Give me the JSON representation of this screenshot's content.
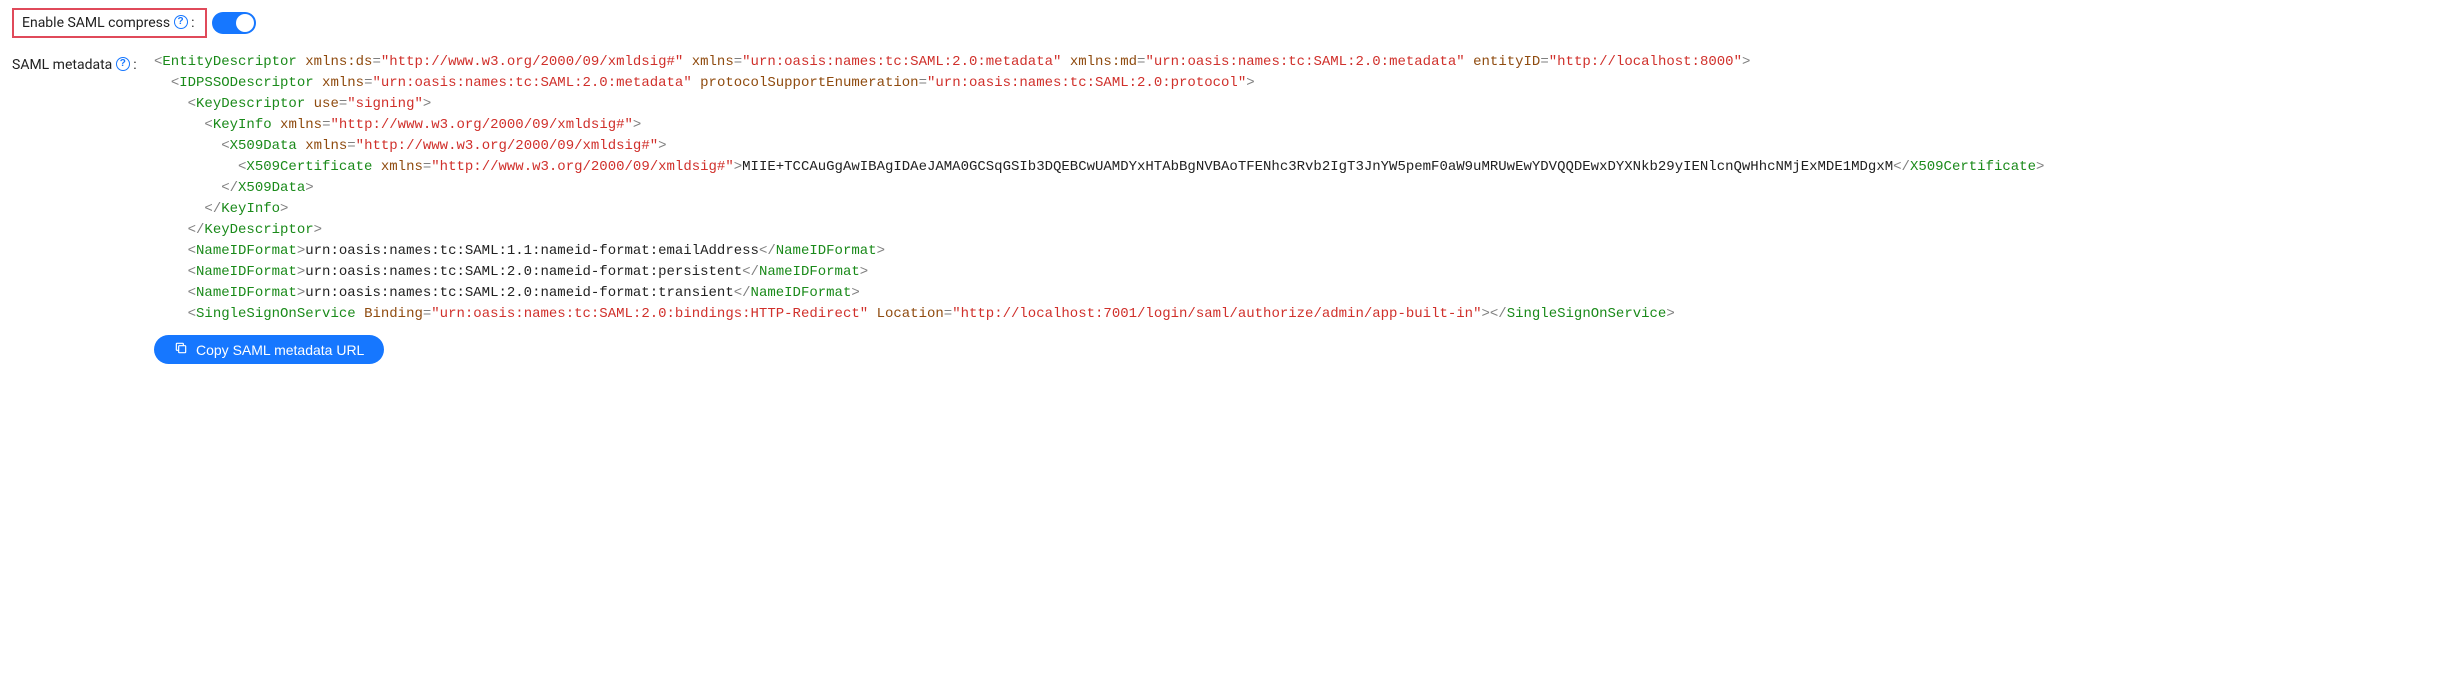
{
  "enable_compress": {
    "label": "Enable SAML compress",
    "help_tooltip": "Help",
    "value": true
  },
  "metadata": {
    "label": "SAML metadata",
    "help_tooltip": "Help",
    "copy_button": "Copy SAML metadata URL",
    "xml": [
      {
        "indent": 0,
        "type": "open",
        "tag": "EntityDescriptor",
        "attrs": [
          [
            "xmlns:ds",
            "http://www.w3.org/2000/09/xmldsig#"
          ],
          [
            "xmlns",
            "urn:oasis:names:tc:SAML:2.0:metadata"
          ],
          [
            "xmlns:md",
            "urn:oasis:names:tc:SAML:2.0:metadata"
          ],
          [
            "entityID",
            "http://localhost:8000"
          ]
        ]
      },
      {
        "indent": 1,
        "type": "open",
        "tag": "IDPSSODescriptor",
        "attrs": [
          [
            "xmlns",
            "urn:oasis:names:tc:SAML:2.0:metadata"
          ],
          [
            "protocolSupportEnumeration",
            "urn:oasis:names:tc:SAML:2.0:protocol"
          ]
        ]
      },
      {
        "indent": 2,
        "type": "open",
        "tag": "KeyDescriptor",
        "attrs": [
          [
            "use",
            "signing"
          ]
        ]
      },
      {
        "indent": 3,
        "type": "open",
        "tag": "KeyInfo",
        "attrs": [
          [
            "xmlns",
            "http://www.w3.org/2000/09/xmldsig#"
          ]
        ]
      },
      {
        "indent": 4,
        "type": "open",
        "tag": "X509Data",
        "attrs": [
          [
            "xmlns",
            "http://www.w3.org/2000/09/xmldsig#"
          ]
        ]
      },
      {
        "indent": 5,
        "type": "openclose",
        "tag": "X509Certificate",
        "attrs": [
          [
            "xmlns",
            "http://www.w3.org/2000/09/xmldsig#"
          ]
        ],
        "text": "MIIE+TCCAuGgAwIBAgIDAeJAMA0GCSqGSIb3DQEBCwUAMDYxHTAbBgNVBAoTFENhc3Rvb2IgT3JnYW5pemF0aW9uMRUwEwYDVQQDEwxDYXNkb29yIENlcnQwHhcNMjExMDE1MDgxM"
      },
      {
        "indent": 4,
        "type": "close",
        "tag": "X509Data"
      },
      {
        "indent": 3,
        "type": "close",
        "tag": "KeyInfo"
      },
      {
        "indent": 2,
        "type": "close",
        "tag": "KeyDescriptor"
      },
      {
        "indent": 2,
        "type": "openclose",
        "tag": "NameIDFormat",
        "attrs": [],
        "text": "urn:oasis:names:tc:SAML:1.1:nameid-format:emailAddress"
      },
      {
        "indent": 2,
        "type": "openclose",
        "tag": "NameIDFormat",
        "attrs": [],
        "text": "urn:oasis:names:tc:SAML:2.0:nameid-format:persistent"
      },
      {
        "indent": 2,
        "type": "openclose",
        "tag": "NameIDFormat",
        "attrs": [],
        "text": "urn:oasis:names:tc:SAML:2.0:nameid-format:transient"
      },
      {
        "indent": 2,
        "type": "openclose",
        "tag": "SingleSignOnService",
        "attrs": [
          [
            "Binding",
            "urn:oasis:names:tc:SAML:2.0:bindings:HTTP-Redirect"
          ],
          [
            "Location",
            "http://localhost:7001/login/saml/authorize/admin/app-built-in"
          ]
        ],
        "text": ""
      }
    ]
  }
}
